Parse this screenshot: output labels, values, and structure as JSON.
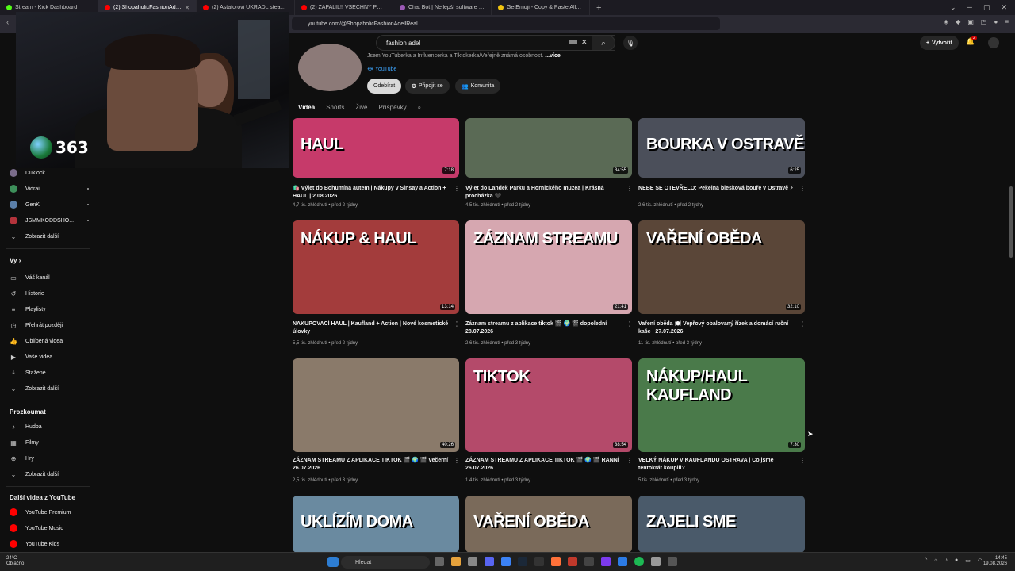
{
  "browser": {
    "tabs": [
      {
        "label": "Stream - Kick Dashboard",
        "color": "#53fc18"
      },
      {
        "label": "(2) ShopaholicFashionAdellReal",
        "color": "#ff0000"
      },
      {
        "label": "(2) Astatorovi UKRADL steam účet H",
        "color": "#ff0000"
      },
      {
        "label": "(2) ZAPALIL!! VŠECHNY PO AUTA! | T",
        "color": "#ff0000"
      },
      {
        "label": "Chat Bot | Nejlepší software pro vyto",
        "color": "#9b59b6"
      },
      {
        "label": "GetEmoji - Copy & Paste All Emojis",
        "color": "#f1c40f"
      }
    ],
    "new_tab": "+",
    "url": "youtube.com/@ShopaholicFashionAdellReal"
  },
  "youtube": {
    "search_value": "fashion adel",
    "create_label": "Vytvořit",
    "notif_count": "2",
    "channel": {
      "description": "Jsem YouTuberka a Influencerka a Tiktokerka/Veřejně známá osobnost.",
      "more": "...více",
      "link": "YouTube",
      "subscribe": "Odebírat",
      "join": "Připojit se",
      "community": "Komunita"
    },
    "tabs": [
      "Videa",
      "Shorts",
      "Živě",
      "Příspěvky"
    ]
  },
  "sidebar": {
    "subs_partial": [
      "Duklock",
      "Vidrail",
      "GenK",
      "JSMMKODDSHO..."
    ],
    "show_more_1": "Zobrazit další",
    "you_heading": "Vy",
    "you_items": [
      "Váš kanál",
      "Historie",
      "Playlisty",
      "Přehrát později",
      "Oblíbená videa",
      "Vaše videa",
      "Stažené",
      "Zobrazit další"
    ],
    "explore_heading": "Prozkoumat",
    "explore_items": [
      "Hudba",
      "Filmy",
      "Hry",
      "Zobrazit další"
    ],
    "more_heading": "Další videa z YouTube",
    "more_items": [
      "YouTube Premium",
      "YouTube Music",
      "YouTube Kids"
    ]
  },
  "overlay": {
    "counter": "363"
  },
  "videos": [
    {
      "thumb_text": "HAUL",
      "duration": "7:18",
      "title": "🛍️ Výlet do Bohumína autem | Nákupy v Sinsay a Action + HAUL | 2.08.2026",
      "meta": "4,7 tis. zhlédnutí • před 2 týdny"
    },
    {
      "thumb_text": "",
      "duration": "34:55",
      "title": "Výlet do Landek Parku a Hornického muzea | Krásná procházka 🖤",
      "meta": "4,5 tis. zhlédnutí • před 2 týdny"
    },
    {
      "thumb_text": "BOURKA V OSTRAVĚ",
      "duration": "6:25",
      "title": "NEBE SE OTEVŘELO: Pekelná blesková bouře v Ostravě ⚡",
      "meta": "2,6 tis. zhlédnutí • před 2 týdny"
    },
    {
      "thumb_text": "NÁKUP & HAUL",
      "duration": "13:14",
      "title": "NAKUPOVACÍ HAUL | Kaufland + Action | Nové kosmetické úlovky",
      "meta": "5,5 tis. zhlédnutí • před 2 týdny"
    },
    {
      "thumb_text": "ZÁZNAM STREAMU",
      "duration": "21:41",
      "title": "Záznam streamu z aplikace tiktok 🎬 🌍 🎬 dopolední 28.07.2026",
      "meta": "2,6 tis. zhlédnutí • před 3 týdny"
    },
    {
      "thumb_text": "VAŘENÍ OBĚDA",
      "duration": "32:10",
      "title": "Vaření oběda 🍽️ Vepřový obalovaný řízek a domácí ruční kaše | 27.07.2026",
      "meta": "11 tis. zhlédnutí • před 3 týdny"
    },
    {
      "thumb_text": "",
      "duration": "40:26",
      "title": "ZÁZNAM STREAMU Z APLIKACE TIKTOK 🎬 🌍 🎬 večerní 26.07.2026",
      "meta": "2,5 tis. zhlédnutí • před 3 týdny"
    },
    {
      "thumb_text": "TIKTOK",
      "duration": "38:54",
      "title": "ZÁZNAM STREAMU Z APLIKACE TIKTOK 🎬 🌍 🎬 RANNÍ 26.07.2026",
      "meta": "1,4 tis. zhlédnutí • před 3 týdny"
    },
    {
      "thumb_text": "NÁKUP/HAUL KAUFLAND",
      "duration": "7:30",
      "title": "VELKÝ NÁKUP V KAUFLANDU OSTRAVA | Co jsme tentokrát koupili?",
      "meta": "5 tis. zhlédnutí • před 3 týdny"
    },
    {
      "thumb_text": "UKLÍZÍM DOMA",
      "duration": "",
      "title": "",
      "meta": ""
    },
    {
      "thumb_text": "VAŘENÍ OBĚDA",
      "duration": "",
      "title": "",
      "meta": ""
    },
    {
      "thumb_text": "ZAJELI SME",
      "duration": "",
      "title": "",
      "meta": ""
    }
  ],
  "taskbar": {
    "weather_temp": "24°C",
    "weather_desc": "Oblačno",
    "search": "Hledat",
    "time": "14:45",
    "date": "19.08.2026"
  }
}
